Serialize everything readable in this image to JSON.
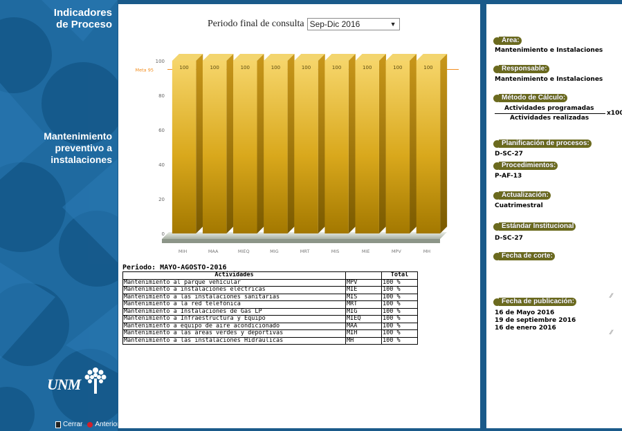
{
  "sidebar": {
    "title_line1": "Indicadores",
    "title_line2": "de Proceso",
    "indicator_line1": "Mantenimiento",
    "indicator_line2": "preventivo a",
    "indicator_line3": "instalaciones",
    "logo_text": "UNM",
    "close_label": "Cerrar",
    "back_label": "Anterior",
    "colors": {
      "bg": "#1f6aa0",
      "pattern": "#0e4f7e"
    }
  },
  "filter": {
    "label": "Periodo final de consulta",
    "selected": "Sep-Dic 2016"
  },
  "chart_data": {
    "type": "bar",
    "categories": [
      "MIH",
      "MAA",
      "MIEQ",
      "MIG",
      "MRT",
      "MIS",
      "MIE",
      "MPV",
      "MH"
    ],
    "values": [
      100,
      100,
      100,
      100,
      100,
      100,
      100,
      100,
      100
    ],
    "data_labels": [
      "100",
      "100",
      "100",
      "100",
      "100",
      "100",
      "100",
      "100",
      "100"
    ],
    "ylim": [
      0,
      100
    ],
    "yticks": [
      0,
      20,
      40,
      60,
      80,
      100
    ],
    "target": {
      "label": "Meta 95",
      "value": 95,
      "color": "#f28c1c"
    },
    "bar_color": "#e6b82c",
    "grid": false
  },
  "table": {
    "period_label": "Periodo: MAYO-AGOSTO-2016",
    "headers": [
      "Actividades",
      "",
      "Total"
    ],
    "rows": [
      [
        "Mantenimiento al parque vehícular",
        "MPV",
        "100 %"
      ],
      [
        "Mantenimiento a instalaciones eléctricas",
        "MIE",
        "100 %"
      ],
      [
        "Mantenimiento a las instalaciones sanitarias",
        "MIS",
        "100 %"
      ],
      [
        "Mantenimiento a la red telefónica",
        "MRT",
        "100 %"
      ],
      [
        "Mantenimiento a Instalaciones de Gas LP",
        "MIG",
        "100 %"
      ],
      [
        "Mantenimiento a Infraestructura y Equipo",
        "MIEQ",
        "100 %"
      ],
      [
        "Mantenimiento a equipo de aire acondicionado",
        "MAA",
        "100 %"
      ],
      [
        "Mantenimiento a las áreas verdes y deportivas",
        "MIH",
        "100 %"
      ],
      [
        "Mantenimiento a las instalaciones Hidráulicas",
        "MH",
        "100 %"
      ]
    ]
  },
  "info": {
    "area_label": "Área:",
    "area_value": "Mantenimiento e Instalaciones",
    "responsable_label": "Responsable:",
    "responsable_value": "Mantenimiento e Instalaciones",
    "metodo_label": "Método de Cálculo:",
    "metodo_numerator": "Actividades programadas",
    "metodo_denominator": "Actividades realizadas",
    "metodo_factor": "x100",
    "planificacion_label": "Planificación de procesos:",
    "planificacion_value": "D-SC-27",
    "procedimientos_label": "Procedimientos:",
    "procedimientos_value": "P-AF-13",
    "actualizacion_label": "Actualización:",
    "actualizacion_value": "Cuatrimestral",
    "estandar_label": "Estándar Institucional",
    "estandar_value": "D-SC-27",
    "corte_label": "Fecha de corte:",
    "publicacion_label": "Fecha de publicación:",
    "publicacion_dates": [
      "16 de Mayo 2016",
      "19 de septiembre 2016",
      "16 de enero 2016"
    ],
    "label_color": "#6b6a1e"
  }
}
